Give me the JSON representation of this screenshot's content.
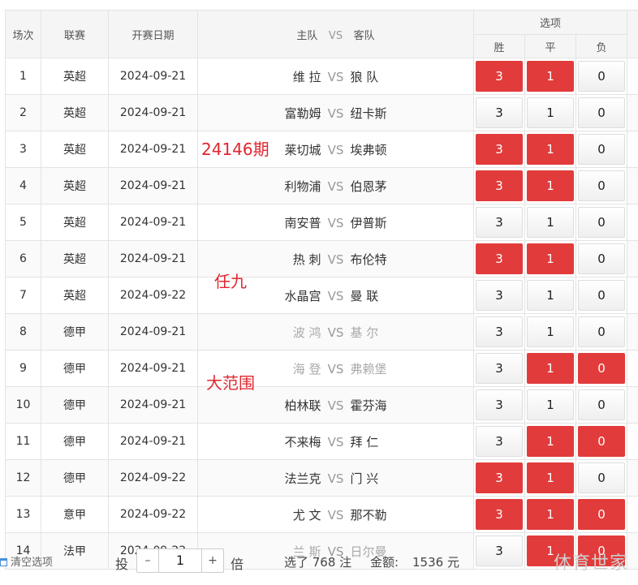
{
  "header": {
    "col_no": "场次",
    "col_league": "联赛",
    "col_date": "开赛日期",
    "col_home": "主队",
    "col_vs": "VS",
    "col_away": "客队",
    "col_options": "选项",
    "opt_win": "胜",
    "opt_draw": "平",
    "opt_loss": "负"
  },
  "option_values": {
    "win": "3",
    "draw": "1",
    "loss": "0"
  },
  "matches": [
    {
      "no": "1",
      "league": "英超",
      "date": "2024-09-21",
      "home": "维 拉",
      "away": "狼 队",
      "selected": [
        "win",
        "draw"
      ]
    },
    {
      "no": "2",
      "league": "英超",
      "date": "2024-09-21",
      "home": "富勒姆",
      "away": "纽卡斯",
      "selected": []
    },
    {
      "no": "3",
      "league": "英超",
      "date": "2024-09-21",
      "home": "莱切城",
      "away": "埃弗顿",
      "selected": [
        "win",
        "draw"
      ]
    },
    {
      "no": "4",
      "league": "英超",
      "date": "2024-09-21",
      "home": "利物浦",
      "away": "伯恩茅",
      "selected": [
        "win",
        "draw"
      ]
    },
    {
      "no": "5",
      "league": "英超",
      "date": "2024-09-21",
      "home": "南安普",
      "away": "伊普斯",
      "selected": []
    },
    {
      "no": "6",
      "league": "英超",
      "date": "2024-09-21",
      "home": "热 刺",
      "away": "布伦特",
      "selected": [
        "win",
        "draw"
      ]
    },
    {
      "no": "7",
      "league": "英超",
      "date": "2024-09-22",
      "home": "水晶宫",
      "away": "曼 联",
      "selected": []
    },
    {
      "no": "8",
      "league": "德甲",
      "date": "2024-09-21",
      "home": "波 鸿",
      "away": "基 尔",
      "selected": [],
      "muted": true
    },
    {
      "no": "9",
      "league": "德甲",
      "date": "2024-09-21",
      "home": "海 登",
      "away": "弗赖堡",
      "selected": [
        "draw",
        "loss"
      ],
      "muted": true
    },
    {
      "no": "10",
      "league": "德甲",
      "date": "2024-09-21",
      "home": "柏林联",
      "away": "霍芬海",
      "selected": []
    },
    {
      "no": "11",
      "league": "德甲",
      "date": "2024-09-21",
      "home": "不来梅",
      "away": "拜 仁",
      "selected": [
        "draw",
        "loss"
      ]
    },
    {
      "no": "12",
      "league": "德甲",
      "date": "2024-09-22",
      "home": "法兰克",
      "away": "门 兴",
      "selected": [
        "win",
        "draw"
      ]
    },
    {
      "no": "13",
      "league": "意甲",
      "date": "2024-09-22",
      "home": "尤 文",
      "away": "那不勒",
      "selected": [
        "win",
        "draw",
        "loss"
      ]
    },
    {
      "no": "14",
      "league": "法甲",
      "date": "2024-09-22",
      "home": "兰 斯",
      "away": "日尔曼",
      "selected": [
        "draw",
        "loss"
      ],
      "muted": true
    }
  ],
  "annotations": [
    "24146期",
    "任九",
    "大范围"
  ],
  "footer": {
    "clear_label": "清空选项",
    "bet_label": "投",
    "minus": "–",
    "multiplier": "1",
    "plus": "+",
    "times_label": "倍",
    "selected_text": "选了 768 注",
    "amount_label": "金额:",
    "amount_value": "1536 元"
  },
  "watermark": "体育世家",
  "colors": {
    "selected": "#e23b3b",
    "annotation": "#e0262f"
  }
}
